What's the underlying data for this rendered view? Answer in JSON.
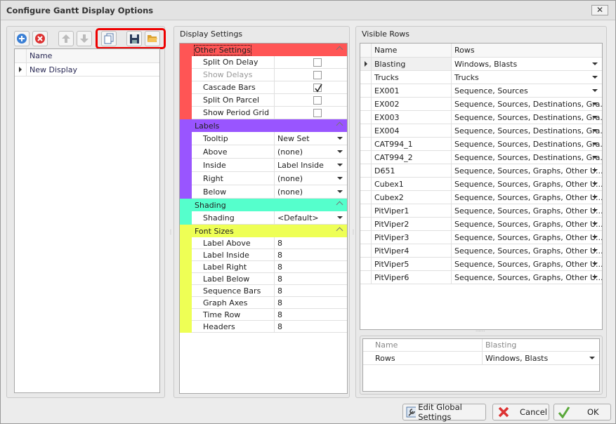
{
  "window": {
    "title": "Configure Gantt Display Options",
    "close": "✕"
  },
  "left": {
    "toolbar": [
      "add-icon",
      "delete-icon",
      "move-up-icon",
      "move-down-icon",
      "copy-icon",
      "save-icon",
      "open-folder-icon"
    ],
    "header": "Name",
    "rows": [
      "New Display"
    ]
  },
  "display_settings": {
    "title": "Display Settings",
    "categories": [
      {
        "name": "Other Settings",
        "color": "#ff5555",
        "type": "check",
        "props": [
          {
            "label": "Split On Delay",
            "checked": false,
            "disabled": false
          },
          {
            "label": "Show Delays",
            "checked": false,
            "disabled": true
          },
          {
            "label": "Cascade Bars",
            "checked": true,
            "disabled": false
          },
          {
            "label": "Split On Parcel",
            "checked": false,
            "disabled": false
          },
          {
            "label": "Show Period Grid",
            "checked": false,
            "disabled": false
          }
        ]
      },
      {
        "name": "Labels",
        "color": "#9955ff",
        "type": "drop",
        "props": [
          {
            "label": "Tooltip",
            "value": "New Set"
          },
          {
            "label": "Above",
            "value": "(none)"
          },
          {
            "label": "Inside",
            "value": "Label Inside"
          },
          {
            "label": "Right",
            "value": "(none)"
          },
          {
            "label": "Below",
            "value": "(none)"
          }
        ]
      },
      {
        "name": "Shading",
        "color": "#55ffcc",
        "type": "drop",
        "props": [
          {
            "label": "Shading",
            "value": "<Default>"
          }
        ]
      },
      {
        "name": "Font Sizes",
        "color": "#eeff55",
        "type": "text",
        "props": [
          {
            "label": "Label Above",
            "value": "8"
          },
          {
            "label": "Label Inside",
            "value": "8"
          },
          {
            "label": "Label Right",
            "value": "8"
          },
          {
            "label": "Label Below",
            "value": "8"
          },
          {
            "label": "Sequence Bars",
            "value": "8"
          },
          {
            "label": "Graph Axes",
            "value": "8"
          },
          {
            "label": "Time Row",
            "value": "8"
          },
          {
            "label": "Headers",
            "value": "8"
          }
        ]
      }
    ]
  },
  "visible_rows": {
    "title": "Visible Rows",
    "headers": [
      "Name",
      "Rows"
    ],
    "rows": [
      [
        "Blasting",
        "Windows, Blasts"
      ],
      [
        "Trucks",
        "Trucks"
      ],
      [
        "EX001",
        "Sequence, Sources"
      ],
      [
        "EX002",
        "Sequence, Sources, Destinations, Gra..."
      ],
      [
        "EX003",
        "Sequence, Sources, Destinations, Gra..."
      ],
      [
        "EX004",
        "Sequence, Sources, Destinations, Gra..."
      ],
      [
        "CAT994_1",
        "Sequence, Sources, Destinations, Gra..."
      ],
      [
        "CAT994_2",
        "Sequence, Sources, Destinations, Gra..."
      ],
      [
        "D651",
        "Sequence, Sources, Graphs, Other U..."
      ],
      [
        "Cubex1",
        "Sequence, Sources, Graphs, Other U..."
      ],
      [
        "Cubex2",
        "Sequence, Sources, Graphs, Other U..."
      ],
      [
        "PitViper1",
        "Sequence, Sources, Graphs, Other U..."
      ],
      [
        "PitViper2",
        "Sequence, Sources, Graphs, Other U..."
      ],
      [
        "PitViper3",
        "Sequence, Sources, Graphs, Other U..."
      ],
      [
        "PitViper4",
        "Sequence, Sources, Graphs, Other U..."
      ],
      [
        "PitViper5",
        "Sequence, Sources, Graphs, Other U..."
      ],
      [
        "PitViper6",
        "Sequence, Sources, Graphs, Other U..."
      ]
    ],
    "detail": {
      "name_label": "Name",
      "name_value": "Blasting",
      "rows_label": "Rows",
      "rows_value": "Windows, Blasts"
    }
  },
  "buttons": {
    "edit_global": "Edit Global Settings",
    "cancel": "Cancel",
    "ok": "OK"
  }
}
